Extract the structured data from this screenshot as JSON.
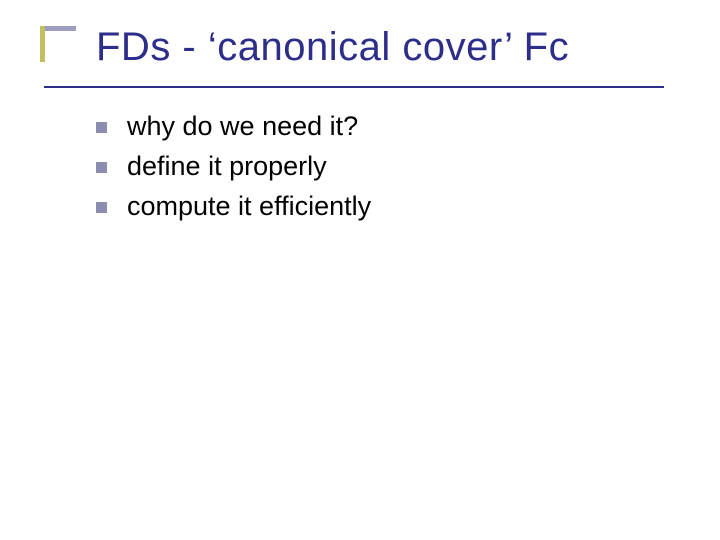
{
  "title": "FDs - ‘canonical cover’ Fc",
  "bullets": [
    {
      "text": "why do we need it?"
    },
    {
      "text": "define it properly"
    },
    {
      "text": "compute it efficiently"
    }
  ]
}
